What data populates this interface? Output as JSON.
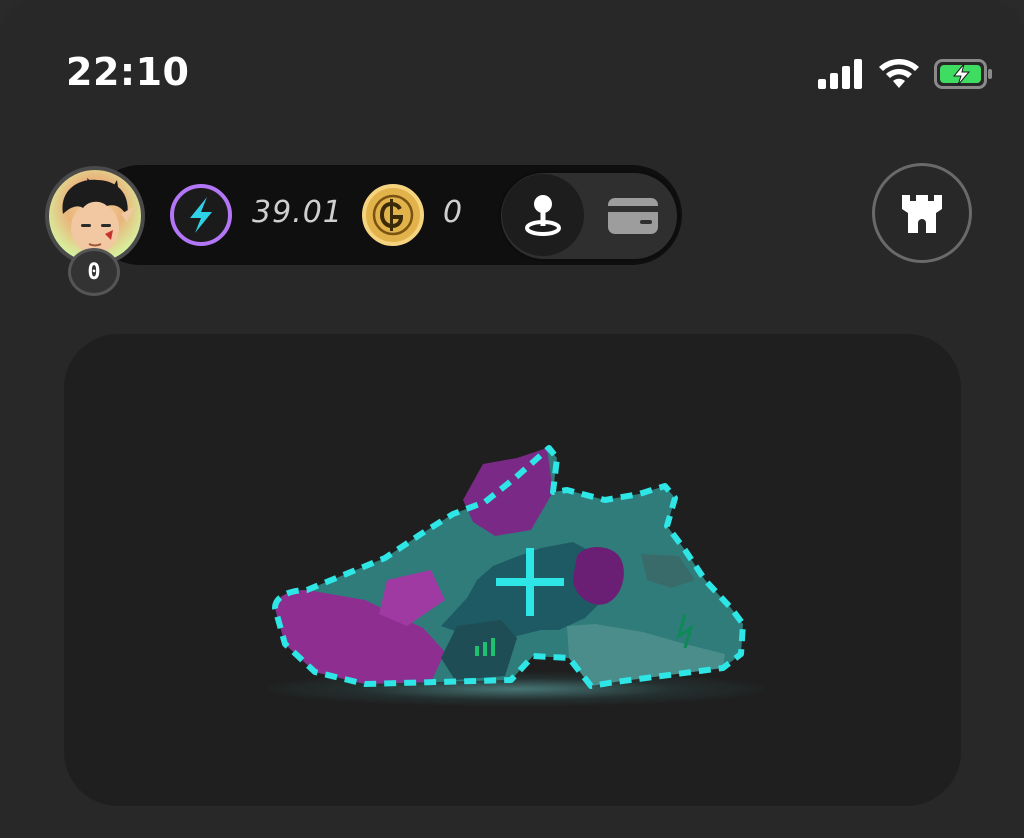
{
  "status_bar": {
    "time": "22:10",
    "icons": [
      "signal-icon",
      "wifi-icon",
      "battery-charging-icon"
    ],
    "battery_color": "#3fdc62"
  },
  "profile": {
    "level": "0"
  },
  "balances": {
    "energy": {
      "icon": "lightning-token-icon",
      "value": "39.01",
      "ring_color": "#b276f7",
      "bolt_color": "#2fd1e6"
    },
    "coin": {
      "icon": "gst-coin-icon",
      "value": "0",
      "color": "#e2b24b"
    }
  },
  "mode_toggle": {
    "options": [
      "joystick-icon",
      "wallet-icon"
    ],
    "selected": "joystick-icon"
  },
  "castle_button": {
    "icon": "castle-icon"
  },
  "sneaker_slot": {
    "icon": "plus-icon",
    "accent": "#2ee6e6",
    "colors": [
      "#8e2e91",
      "#2f7c7a",
      "#1e5a63",
      "#5a2a6a"
    ]
  }
}
